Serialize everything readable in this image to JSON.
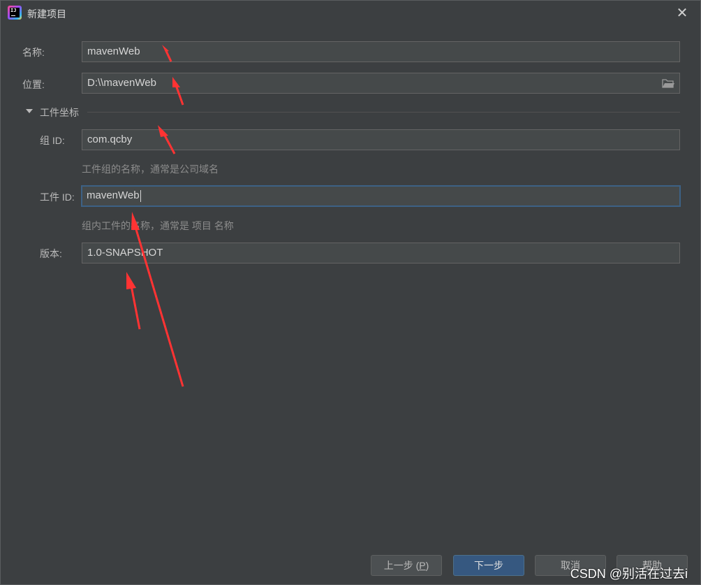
{
  "window": {
    "title": "新建项目",
    "close_glyph": "✕"
  },
  "form": {
    "name": {
      "label": "名称:",
      "value": "mavenWeb"
    },
    "location": {
      "label": "位置:",
      "value": "D:\\\\mavenWeb",
      "icon": "folder-icon"
    },
    "artifact_coordinates": {
      "title": "工件坐标",
      "expanded": true,
      "group_id": {
        "label": "组 ID:",
        "value": "com.qcby",
        "hint": "工件组的名称，通常是公司域名"
      },
      "artifact_id": {
        "label": "工件 ID:",
        "value": "mavenWeb",
        "hint": "组内工件的名称，通常是 项目 名称",
        "focused": true
      },
      "version": {
        "label": "版本:",
        "value": "1.0-SNAPSHOT"
      }
    }
  },
  "buttons": {
    "previous": {
      "label": "上一步 (",
      "mnemonic": "P",
      "suffix": ")"
    },
    "next": {
      "label": "下一步"
    },
    "cancel": {
      "label": "取消"
    },
    "help": {
      "label": "帮助"
    }
  },
  "watermark": "CSDN @别活在过去i",
  "colors": {
    "dialog_bg": "#3c3f41",
    "field_bg": "#45494a",
    "primary_button": "#365880",
    "annotation_arrow": "#ff3333"
  }
}
